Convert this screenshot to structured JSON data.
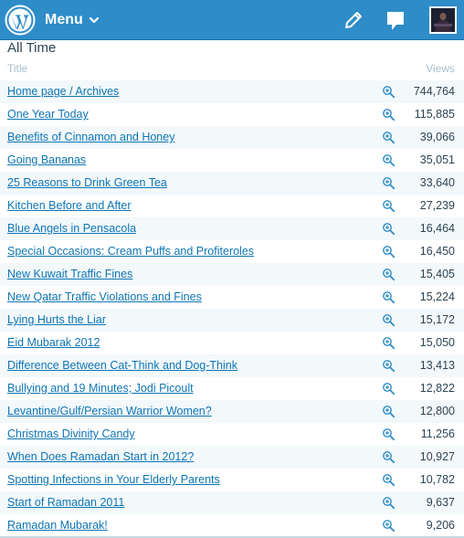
{
  "header": {
    "menu_label": "Menu",
    "brand_color": "#2e8cc8",
    "icons": [
      "wordpress-logo",
      "chevron-down-icon",
      "pencil-icon",
      "notification-bubble-icon",
      "avatar"
    ]
  },
  "stats": {
    "section_title": "All Time",
    "col_title": "Title",
    "col_views": "Views",
    "rows": [
      {
        "title": "Home page / Archives",
        "views": "744,764"
      },
      {
        "title": "One Year Today",
        "views": "115,885"
      },
      {
        "title": "Benefits of Cinnamon and Honey",
        "views": "39,066"
      },
      {
        "title": "Going Bananas",
        "views": "35,051"
      },
      {
        "title": "25 Reasons to Drink Green Tea",
        "views": "33,640"
      },
      {
        "title": "Kitchen Before and After",
        "views": "27,239"
      },
      {
        "title": "Blue Angels in Pensacola",
        "views": "16,464"
      },
      {
        "title": "Special Occasions: Cream Puffs and Profiteroles",
        "views": "16,450"
      },
      {
        "title": "New Kuwait Traffic Fines",
        "views": "15,405"
      },
      {
        "title": "New Qatar Traffic Violations and Fines",
        "views": "15,224"
      },
      {
        "title": "Lying Hurts the Liar",
        "views": "15,172"
      },
      {
        "title": "Eid Mubarak 2012",
        "views": "15,050"
      },
      {
        "title": "Difference Between Cat-Think and Dog-Think",
        "views": "13,413"
      },
      {
        "title": "Bullying and 19 Minutes; Jodi Picoult",
        "views": "12,822"
      },
      {
        "title": "Levantine/Gulf/Persian Warrior Women?",
        "views": "12,800"
      },
      {
        "title": "Christmas Divinity Candy",
        "views": "11,256"
      },
      {
        "title": "When Does Ramadan Start in 2012?",
        "views": "10,927"
      },
      {
        "title": "Spotting Infections in Your Elderly Parents",
        "views": "10,782"
      },
      {
        "title": "Start of Ramadan 2011",
        "views": "9,637"
      },
      {
        "title": "Ramadan Mubarak!",
        "views": "9,206"
      }
    ]
  }
}
